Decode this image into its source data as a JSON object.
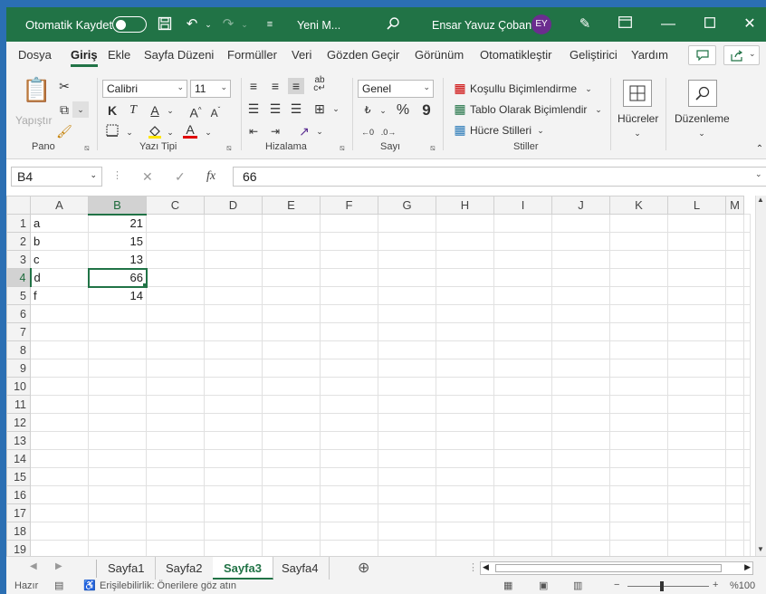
{
  "titlebar": {
    "autosave_label": "Otomatik Kaydet",
    "doc_title": "Yeni M...",
    "user_name": "Ensar Yavuz Çoban",
    "avatar_initials": "EY"
  },
  "menu": {
    "tabs": [
      "Dosya",
      "Giriş",
      "Ekle",
      "Sayfa Düzeni",
      "Formüller",
      "Veri",
      "Gözden Geçir",
      "Görünüm",
      "Otomatikleştir",
      "Geliştirici",
      "Yardım"
    ]
  },
  "ribbon": {
    "paste_label": "Yapıştır",
    "groups": {
      "clipboard": "Pano",
      "font": "Yazı Tipi",
      "alignment": "Hizalama",
      "number": "Sayı",
      "styles": "Stiller"
    },
    "font_name": "Calibri",
    "font_size": "11",
    "number_format": "Genel",
    "conditional_formatting": "Koşullu Biçimlendirme",
    "format_as_table": "Tablo Olarak Biçimlendir",
    "cell_styles": "Hücre Stilleri",
    "cells": "Hücreler",
    "editing": "Düzenleme",
    "bold": "K",
    "italic": "T",
    "underline": "A"
  },
  "formula_bar": {
    "name_box": "B4",
    "content": "66",
    "fx": "fx"
  },
  "grid": {
    "columns": [
      "A",
      "B",
      "C",
      "D",
      "E",
      "F",
      "G",
      "H",
      "I",
      "J",
      "K",
      "L",
      "M"
    ],
    "rows": [
      {
        "n": "1",
        "a": "a",
        "b": "21"
      },
      {
        "n": "2",
        "a": "b",
        "b": "15"
      },
      {
        "n": "3",
        "a": "c",
        "b": "13"
      },
      {
        "n": "4",
        "a": "d",
        "b": "66"
      },
      {
        "n": "5",
        "a": "f",
        "b": "14"
      },
      {
        "n": "6",
        "a": "",
        "b": ""
      },
      {
        "n": "7",
        "a": "",
        "b": ""
      },
      {
        "n": "8",
        "a": "",
        "b": ""
      },
      {
        "n": "9",
        "a": "",
        "b": ""
      },
      {
        "n": "10",
        "a": "",
        "b": ""
      },
      {
        "n": "11",
        "a": "",
        "b": ""
      },
      {
        "n": "12",
        "a": "",
        "b": ""
      },
      {
        "n": "13",
        "a": "",
        "b": ""
      },
      {
        "n": "14",
        "a": "",
        "b": ""
      },
      {
        "n": "15",
        "a": "",
        "b": ""
      },
      {
        "n": "16",
        "a": "",
        "b": ""
      },
      {
        "n": "17",
        "a": "",
        "b": ""
      },
      {
        "n": "18",
        "a": "",
        "b": ""
      },
      {
        "n": "19",
        "a": "",
        "b": ""
      }
    ]
  },
  "sheets": [
    "Sayfa1",
    "Sayfa2",
    "Sayfa3",
    "Sayfa4"
  ],
  "active_sheet": "Sayfa3",
  "status": {
    "ready": "Hazır",
    "accessibility": "Erişilebilirlik: Önerilere göz atın",
    "zoom": "%100"
  },
  "colors": {
    "accent": "#217346",
    "avatar": "#6b2d8f"
  }
}
